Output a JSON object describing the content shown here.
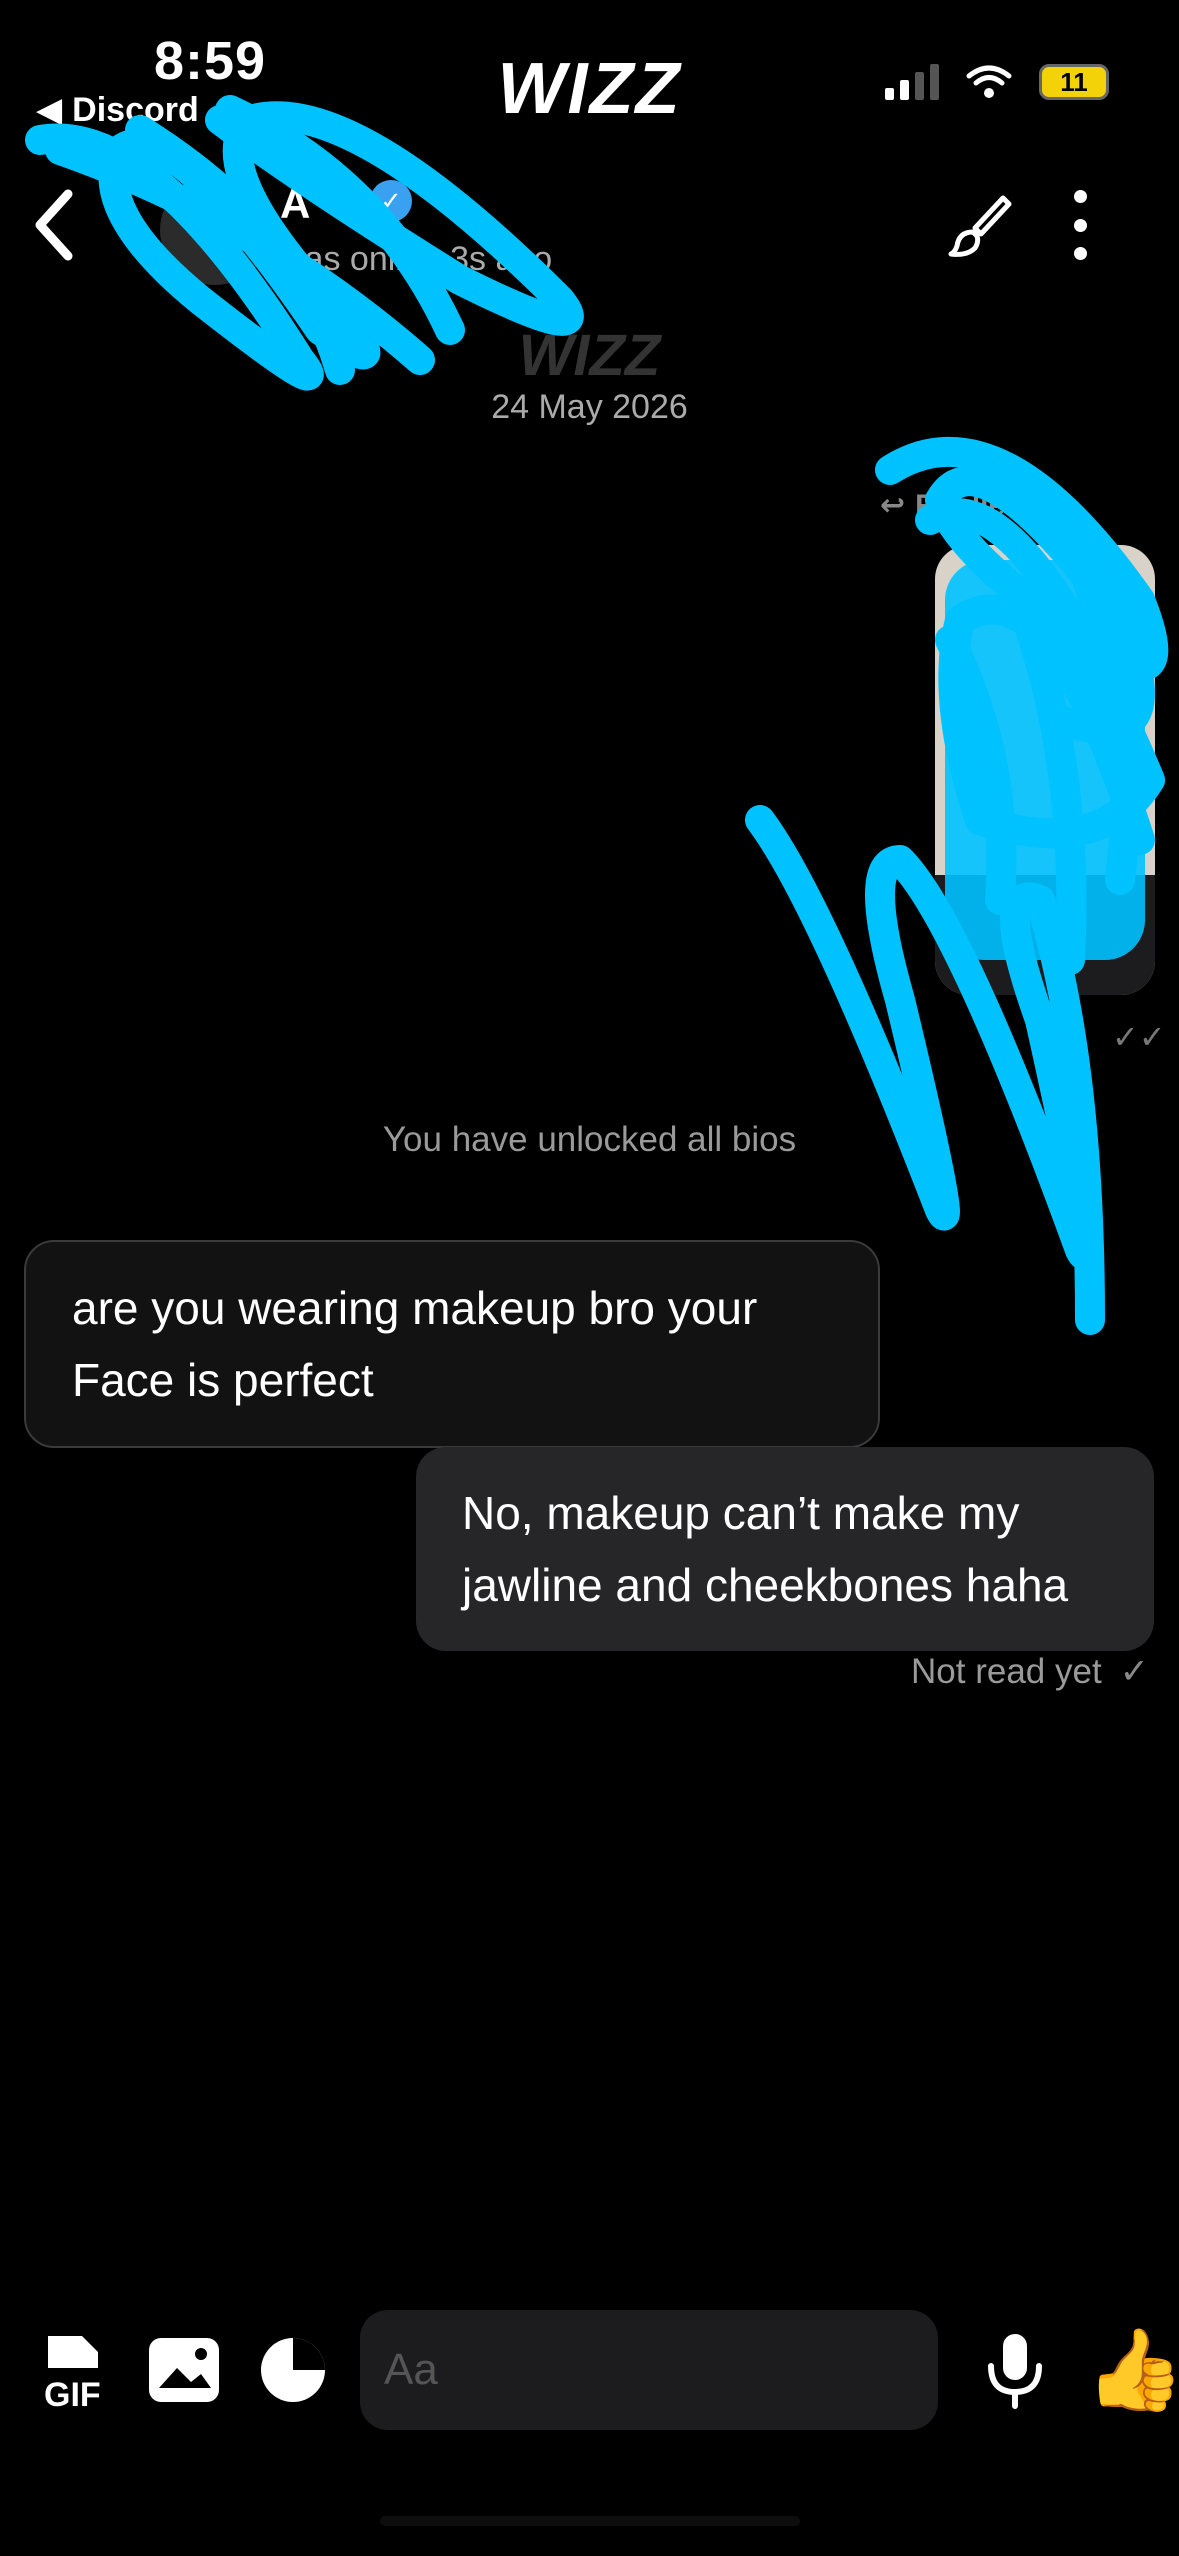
{
  "status_bar": {
    "time": "8:59",
    "back_app": "Discord",
    "battery": "11"
  },
  "app": {
    "brand": "WIZZ"
  },
  "header": {
    "contact_name": "A",
    "status": "was online 3s ago"
  },
  "conversation": {
    "date_brand": "WIZZ",
    "date": "24 May 2026",
    "reply_label": "Replied to",
    "unlocked_notice": "You have unlocked all bios",
    "messages": [
      {
        "direction": "incoming",
        "text": "are you wearing makeup bro your Face is perfect"
      },
      {
        "direction": "outgoing",
        "text": "No, makeup can’t make my jawline and cheekbones haha"
      }
    ],
    "receipt": "Not read yet"
  },
  "composer": {
    "placeholder": "Aa",
    "gif_label": "GIF",
    "like_emoji": "👍"
  },
  "colors": {
    "background": "#000000",
    "incoming_bubble": "#121212",
    "outgoing_bubble": "#262628",
    "scribble": "#00c2ff",
    "verified": "#3aa0f0"
  }
}
